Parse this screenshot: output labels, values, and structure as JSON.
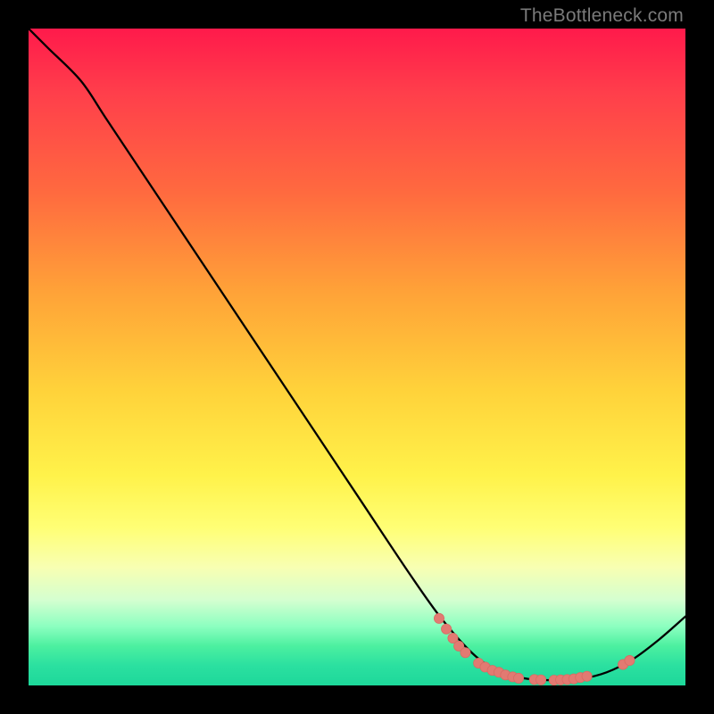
{
  "watermark": "TheBottleneck.com",
  "colors": {
    "dot_fill": "#e27a72",
    "dot_stroke": "#d96b63",
    "curve_stroke": "#000000"
  },
  "chart_data": {
    "type": "line",
    "title": "",
    "xlabel": "",
    "ylabel": "",
    "xlim": [
      0,
      100
    ],
    "ylim": [
      0,
      100
    ],
    "curve": [
      {
        "x": 0,
        "y": 100
      },
      {
        "x": 3,
        "y": 97
      },
      {
        "x": 8,
        "y": 92
      },
      {
        "x": 12,
        "y": 86
      },
      {
        "x": 20,
        "y": 74
      },
      {
        "x": 30,
        "y": 59
      },
      {
        "x": 40,
        "y": 44
      },
      {
        "x": 50,
        "y": 29
      },
      {
        "x": 58,
        "y": 17
      },
      {
        "x": 63,
        "y": 10
      },
      {
        "x": 68,
        "y": 4.5
      },
      {
        "x": 72,
        "y": 2
      },
      {
        "x": 76,
        "y": 1
      },
      {
        "x": 80,
        "y": 0.8
      },
      {
        "x": 84,
        "y": 1
      },
      {
        "x": 88,
        "y": 2
      },
      {
        "x": 92,
        "y": 4
      },
      {
        "x": 96,
        "y": 7
      },
      {
        "x": 100,
        "y": 10.5
      }
    ],
    "dots": [
      {
        "x": 62.5,
        "y": 10.2
      },
      {
        "x": 63.6,
        "y": 8.6
      },
      {
        "x": 64.6,
        "y": 7.2
      },
      {
        "x": 65.5,
        "y": 6.0
      },
      {
        "x": 66.5,
        "y": 5.0
      },
      {
        "x": 68.5,
        "y": 3.4
      },
      {
        "x": 69.5,
        "y": 2.8
      },
      {
        "x": 70.6,
        "y": 2.3
      },
      {
        "x": 71.6,
        "y": 2.0
      },
      {
        "x": 72.6,
        "y": 1.6
      },
      {
        "x": 73.7,
        "y": 1.3
      },
      {
        "x": 74.6,
        "y": 1.1
      },
      {
        "x": 77.0,
        "y": 0.9
      },
      {
        "x": 78.0,
        "y": 0.85
      },
      {
        "x": 80.0,
        "y": 0.8
      },
      {
        "x": 81.0,
        "y": 0.85
      },
      {
        "x": 82.0,
        "y": 0.9
      },
      {
        "x": 83.0,
        "y": 1.0
      },
      {
        "x": 84.0,
        "y": 1.2
      },
      {
        "x": 85.0,
        "y": 1.4
      },
      {
        "x": 90.5,
        "y": 3.2
      },
      {
        "x": 91.5,
        "y": 3.8
      }
    ]
  }
}
